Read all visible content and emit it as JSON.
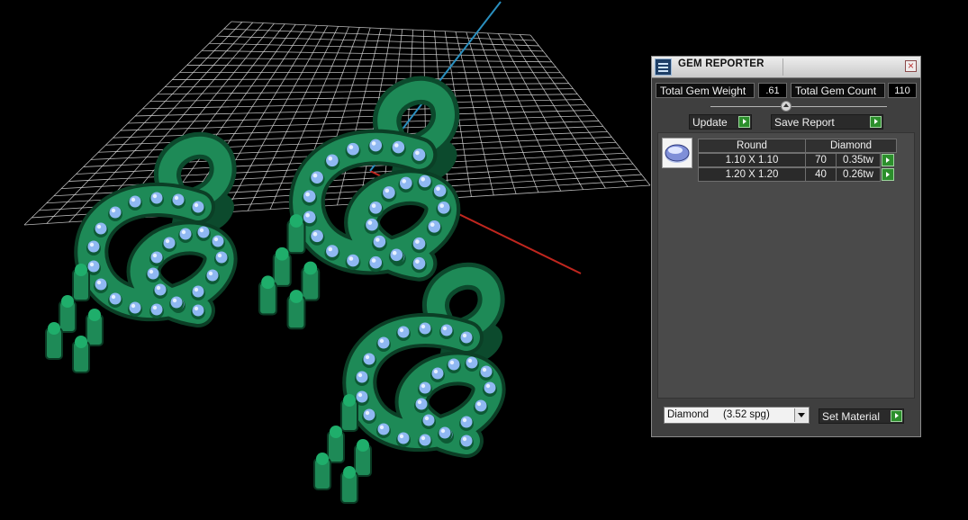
{
  "colors": {
    "background": "#000000",
    "grid": "#d9d9d9",
    "axis_x": "#c0261e",
    "axis_y": "#2a8fbf",
    "metal": "#1e8a57",
    "gem": "#8fb8f2",
    "panel_bg": "#3f3f3f",
    "action_green": "#2c8f2c"
  },
  "gem_reporter": {
    "title": "GEM REPORTER",
    "title_icon": "gem-reporter-app-icon",
    "close_icon": "close-icon",
    "total_weight_label": "Total Gem Weight",
    "total_weight_value": ".61",
    "total_count_label": "Total Gem Count",
    "total_count_value": "110",
    "update_label": "Update",
    "save_report_label": "Save Report",
    "table": {
      "shape": "Round",
      "material": "Diamond",
      "gem_icon": "round-gem-icon",
      "rows": [
        {
          "size": "1.10 X 1.10",
          "count": "70",
          "weight": "0.35tw"
        },
        {
          "size": "1.20 X 1.20",
          "count": "40",
          "weight": "0.26tw"
        }
      ]
    },
    "material_select_value": "Diamond     (3.52 spg)",
    "set_material_label": "Set Material"
  }
}
